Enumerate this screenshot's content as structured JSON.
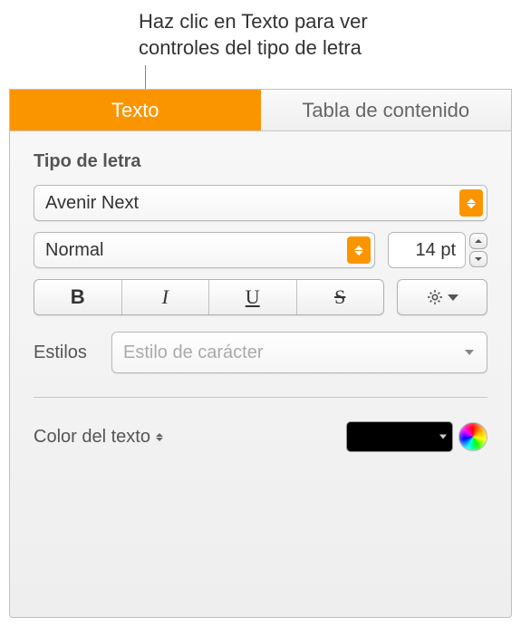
{
  "annotation": {
    "line1": "Haz clic en Texto para ver",
    "line2": "controles del tipo de letra"
  },
  "tabs": {
    "text": "Texto",
    "toc": "Tabla de contenido"
  },
  "font": {
    "section_label": "Tipo de letra",
    "family": "Avenir Next",
    "style": "Normal",
    "size": "14 pt",
    "bold_glyph": "B",
    "italic_glyph": "I",
    "underline_glyph": "U",
    "strike_glyph": "S"
  },
  "char_style": {
    "label": "Estilos",
    "placeholder": "Estilo de carácter"
  },
  "text_color": {
    "label": "Color del texto",
    "swatch": "#000000"
  }
}
